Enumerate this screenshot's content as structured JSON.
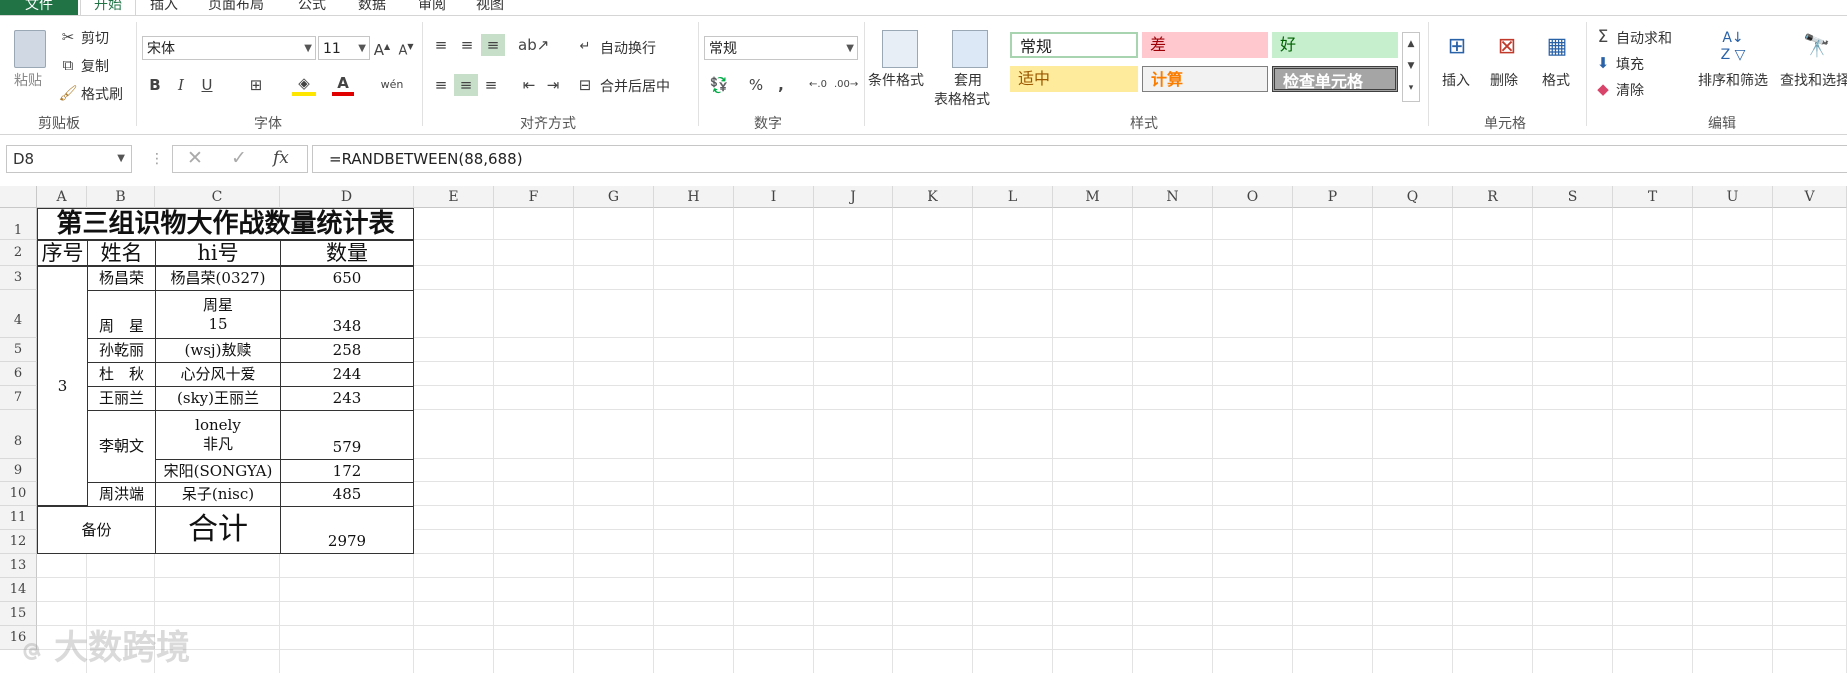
{
  "tabs": [
    "文件",
    "开始",
    "插入",
    "页面布局",
    "公式",
    "数据",
    "审阅",
    "视图"
  ],
  "clipboard": {
    "paste": "粘贴",
    "cut": "剪切",
    "copy": "复制",
    "format_painter": "格式刷",
    "group": "剪贴板"
  },
  "font": {
    "name": "宋体",
    "size": "11",
    "group": "字体"
  },
  "alignment": {
    "wrap": "自动换行",
    "merge": "合并后居中",
    "group": "对齐方式"
  },
  "number": {
    "format": "常规",
    "group": "数字"
  },
  "styles": {
    "conditional": "条件格式",
    "table_format_1": "套用",
    "table_format_2": "表格格式",
    "normal": "常规",
    "bad": "差",
    "good": "好",
    "neutral": "适中",
    "calculation": "计算",
    "check": "检查单元格",
    "group": "样式"
  },
  "cells_group": {
    "insert": "插入",
    "delete": "删除",
    "format": "格式",
    "group": "单元格"
  },
  "editing": {
    "autosum": "自动求和",
    "fill": "填充",
    "clear": "清除",
    "sort": "排序和筛选",
    "find": "查找和选择",
    "group": "编辑"
  },
  "formula_bar": {
    "name_box": "D8",
    "formula": "=RANDBETWEEN(88,688)"
  },
  "columns": [
    "A",
    "B",
    "C",
    "D",
    "E",
    "F",
    "G",
    "H",
    "I",
    "J",
    "K",
    "L",
    "M",
    "N",
    "O",
    "P",
    "Q",
    "R",
    "S",
    "T",
    "U",
    "V"
  ],
  "rows": [
    "1",
    "2",
    "3",
    "4",
    "5",
    "6",
    "7",
    "8",
    "9",
    "10",
    "11",
    "12",
    "13",
    "14",
    "15",
    "16"
  ],
  "sheet": {
    "title": "第三组识物大作战数量统计表",
    "headers": {
      "seq": "序号",
      "name": "姓名",
      "hi": "hi号",
      "qty": "数量"
    },
    "group_no": "3",
    "records": [
      {
        "name": "杨昌荣",
        "hi": "杨昌荣(0327)",
        "qty": "650"
      },
      {
        "name": "周　星",
        "hi": "周星\n15",
        "qty": "348"
      },
      {
        "name": "孙乾丽",
        "hi": "(wsj)敖赎",
        "qty": "258"
      },
      {
        "name": "杜　秋",
        "hi": "心分风十爱",
        "qty": "244"
      },
      {
        "name": "王丽兰",
        "hi": "(sky)王丽兰",
        "qty": "243"
      },
      {
        "name": "李朝文",
        "hi": "lonely\n非凡",
        "qty": "579"
      },
      {
        "name": "",
        "hi": "宋阳(SONGYA)",
        "qty": "172"
      },
      {
        "name": "周洪端",
        "hi": "呆子(nisc)",
        "qty": "485"
      }
    ],
    "backup": "备份",
    "total_label": "合计",
    "total_value": "2979"
  },
  "watermark": "大数跨境"
}
